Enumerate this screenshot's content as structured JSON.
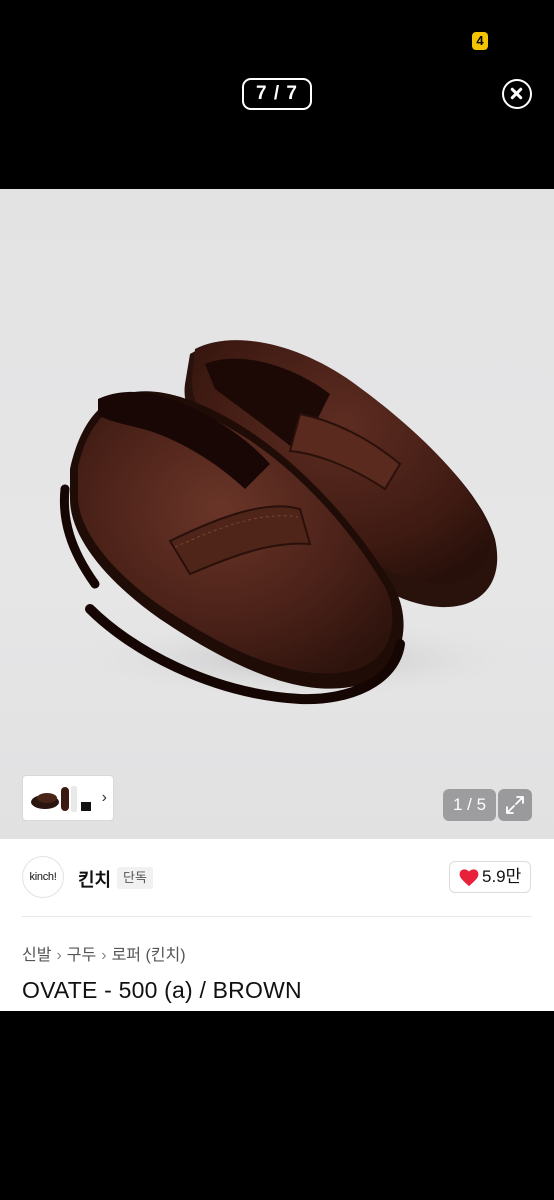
{
  "status": {
    "badge": "4"
  },
  "viewer": {
    "counter": "7 / 7"
  },
  "gallery": {
    "page_indicator": "1 / 5"
  },
  "brand": {
    "logo_text": "kinch!",
    "name": "킨치",
    "tag": "단독"
  },
  "like": {
    "count": "5.9만",
    "color": "#e8203a"
  },
  "breadcrumb": {
    "items": [
      "신발",
      "구두",
      "로퍼 (킨치)"
    ]
  },
  "product": {
    "title": "OVATE - 500 (a) / BROWN"
  }
}
